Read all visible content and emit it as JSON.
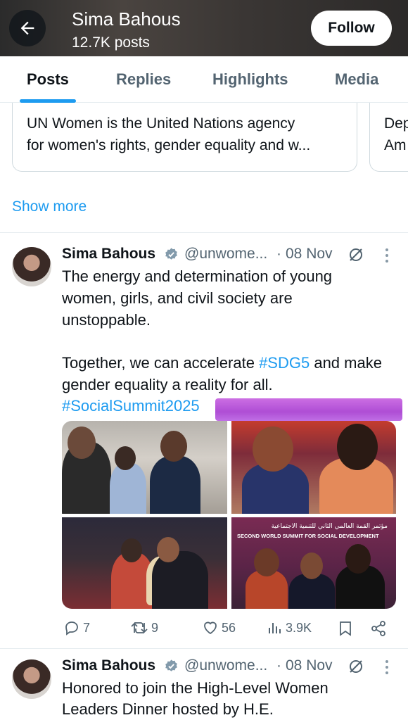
{
  "header": {
    "name": "Sima Bahous",
    "post_count": "12.7K posts",
    "follow_label": "Follow"
  },
  "tabs": [
    {
      "label": "Posts",
      "active": true
    },
    {
      "label": "Replies",
      "active": false
    },
    {
      "label": "Highlights",
      "active": false
    },
    {
      "label": "Media",
      "active": false
    }
  ],
  "bio_cards": [
    {
      "line1": "UN Women is the United Nations agency",
      "line2": "for women's rights, gender equality and w..."
    },
    {
      "line1": "Dep",
      "line2": "Am"
    }
  ],
  "show_more": "Show more",
  "tweets": [
    {
      "name": "Sima Bahous",
      "handle": "@unwome...",
      "sep": "·",
      "date": "08 Nov",
      "lines": [
        "The energy and determination of young",
        "women, girls, and civil society are",
        "unstoppable.",
        "",
        "Together, we can accelerate ",
        "gender equality a reality for all."
      ],
      "inline_hashtag": "#SDG5",
      "after_hashtag": " and make",
      "hashtag_line": "#SocialSummit2025",
      "stats": {
        "replies": "7",
        "reposts": "9",
        "likes": "56",
        "views": "3.9K"
      },
      "photo_banner": {
        "arabic": "مؤتمر القمة العالمي الثاني للتنمية الاجتماعية",
        "english": "SECOND WORLD SUMMIT FOR SOCIAL DEVELOPMENT"
      }
    },
    {
      "name": "Sima Bahous",
      "handle": "@unwome...",
      "sep": "·",
      "date": "08 Nov",
      "lines": [
        "Honored to join the High-Level Women",
        "Leaders Dinner hosted by H.E."
      ]
    }
  ],
  "colors": {
    "accent": "#1d9bf0",
    "text": "#0f1419",
    "muted": "#536471",
    "verified_gold": "#829aab"
  },
  "icons": [
    "back-arrow-icon",
    "verified-icon",
    "grok-icon",
    "more-icon",
    "reply-icon",
    "repost-icon",
    "like-icon",
    "views-icon",
    "bookmark-icon",
    "share-icon"
  ]
}
